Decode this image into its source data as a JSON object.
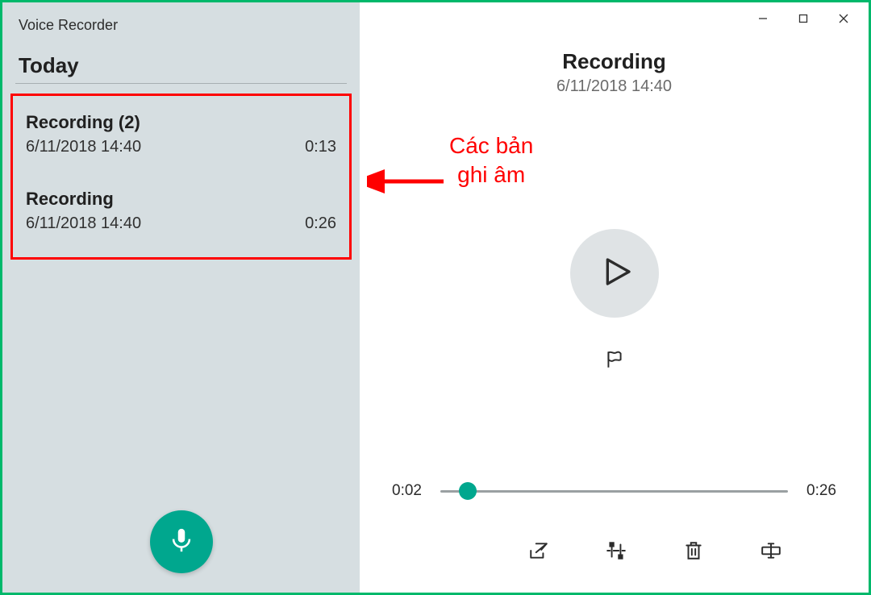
{
  "app": {
    "title": "Voice Recorder"
  },
  "sidebar": {
    "section": "Today",
    "items": [
      {
        "name": "Recording (2)",
        "date": "6/11/2018 14:40",
        "duration": "0:13"
      },
      {
        "name": "Recording",
        "date": "6/11/2018 14:40",
        "duration": "0:26"
      }
    ]
  },
  "detail": {
    "title": "Recording",
    "date": "6/11/2018 14:40",
    "current_time": "0:02",
    "total_time": "0:26",
    "progress_percent": 8
  },
  "icons": {
    "mic": "mic-icon",
    "play": "play-icon",
    "flag": "flag-icon",
    "share": "share-icon",
    "trim": "trim-icon",
    "delete": "delete-icon",
    "rename": "rename-icon",
    "minimize": "minimize-icon",
    "maximize": "maximize-icon",
    "close": "close-icon"
  },
  "annotation": {
    "line1": "Các bản",
    "line2": "ghi âm"
  },
  "colors": {
    "accent": "#00a78e",
    "border": "#00b86b",
    "highlight": "#ff0000"
  }
}
